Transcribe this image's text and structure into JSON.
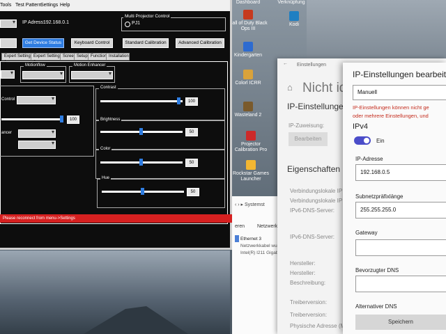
{
  "desktop_icons": [
    {
      "label": "Dashboard"
    },
    {
      "label": "Verknüpfung"
    },
    {
      "label": "Call of Duty Black Ops III"
    },
    {
      "label": "Kodi"
    },
    {
      "label": "Kindergarten"
    },
    {
      "label": "Colorl ICRR"
    },
    {
      "label": "Wasteland 2"
    },
    {
      "label": "Projector Calibration Pro"
    },
    {
      "label": "Rockstar Games Launcher"
    }
  ],
  "app": {
    "menu": [
      "Tools",
      "Test Pattern",
      "Settings",
      "Help"
    ],
    "ip_label": "IP Adress:",
    "ip_value": "192.168.0.1",
    "multi_projector_title": "Multi Projector Control",
    "projector_option": "PJ1",
    "buttons": {
      "device_status": "Get Device Status",
      "keyboard": "Keyboard Control",
      "standard_cal": "Standard Calibration",
      "advanced_cal": "Advanced Calibration"
    },
    "tabs": [
      "Expert Setting 1",
      "Expert Setting 2",
      "Screen",
      "Setup",
      "Function",
      "Installation"
    ],
    "groups": {
      "motionflow": "Motionflow",
      "motion_enhancer": "Motion Enhancer",
      "contrast": "Contrast",
      "brightness": "Brightness",
      "color": "Color",
      "hue": "Hue",
      "control": "Control",
      "ancer": "ancer"
    },
    "slider_values": {
      "contrast": "100",
      "brightness": "50",
      "color": "50",
      "hue": "50",
      "left": "100"
    },
    "status_text": "Please reconnect from menu->Settings"
  },
  "settings_window": {
    "title": "Einstellungen",
    "home_heading": "Nicht ide",
    "ip_settings": "IP-Einstellungen",
    "ip_assign": "IP-Zuweisung:",
    "edit_button": "Bearbeiten",
    "properties": "Eigenschaften",
    "link_local_1": "Verbindungslokale IP",
    "link_local_2": "Verbindungslokale IP",
    "ipv6_dns": "IPv6-DNS-Server:",
    "ipv6_dns_2": "IPv6-DNS-Server:",
    "manufacturer": "Hersteller:",
    "manufacturer_2": "Hersteller:",
    "description": "Beschreibung:",
    "driver_version": "Treiberversion:",
    "driver_version_2": "Treiberversion:",
    "physical_address": "Physische Adresse (MAC):"
  },
  "explorer": {
    "crumb": "Systemst",
    "col1": "eren",
    "col2": "Netzwerkg",
    "item_name": "Ethernet 3",
    "item_line2": "Netzwerkkabel wurde",
    "item_line3": "Intel(R) I211 Gigabit N"
  },
  "ip_dialog": {
    "title": "IP-Einstellungen bearbeiten",
    "mode": "Manuell",
    "error_line1": "IP-Einstellungen können nicht ge",
    "error_line2": "oder mehrere Einstellungen, und",
    "ipv4_label": "IPv4",
    "toggle_label": "Ein",
    "ip_address_label": "IP-Adresse",
    "ip_address_value": "192.168.0.5",
    "subnet_label": "Subnetzpräfixlänge",
    "subnet_value": "255.255.255.0",
    "gateway_label": "Gateway",
    "gateway_value": "",
    "dns_pref_label": "Bevorzugter DNS",
    "dns_pref_value": "",
    "dns_alt_label": "Alternativer DNS",
    "save_button": "Speichern"
  }
}
